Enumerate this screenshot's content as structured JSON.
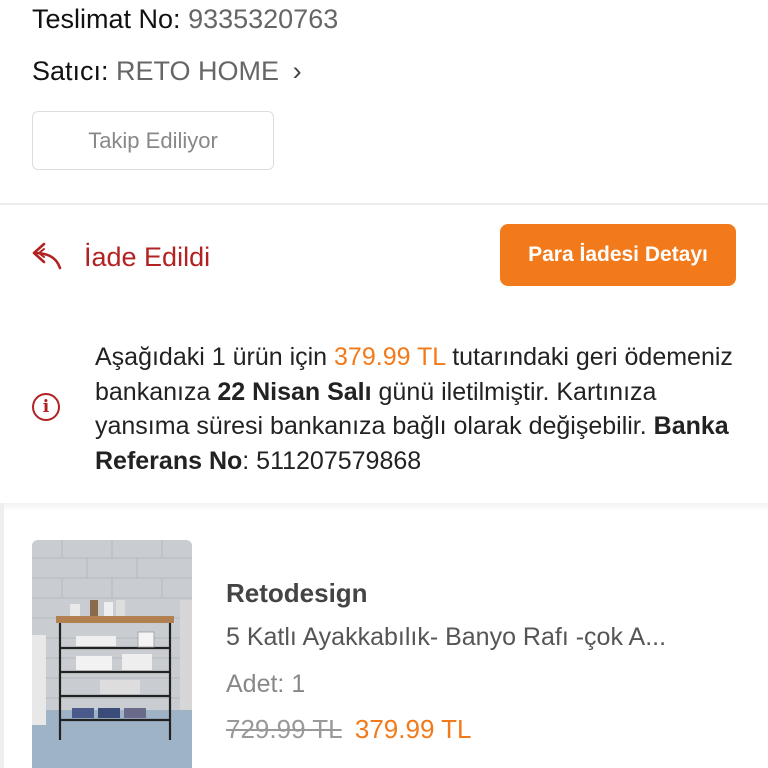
{
  "delivery": {
    "teslimat_label": "Teslimat No:",
    "teslimat_value": "9335320763",
    "satici_label": "Satıcı:",
    "satici_value": "RETO HOME",
    "chevron": "›",
    "follow_label": "Takip Ediliyor"
  },
  "status": {
    "icon": "return-arrow-icon",
    "label": "İade Edildi",
    "refund_button": "Para İadesi Detayı",
    "status_color": "#b22222",
    "accent_color": "#f27a1a"
  },
  "info": {
    "icon": "info-icon",
    "icon_glyph": "i",
    "t1": "Aşağıdaki 1 ürün için ",
    "amount": "379.99 TL",
    "t2": " tutarındaki geri ödemeniz bankanıza ",
    "date": "22 Nisan Salı",
    "t3": " günü iletilmiştir. Kartınıza yansıma süresi bankanıza bağlı olarak değişebilir. ",
    "ref_label": "Banka Referans No",
    "ref_sep": ": ",
    "ref_value": "511207579868"
  },
  "product": {
    "brand": "Retodesign",
    "name": "5 Katlı Ayakkabılık- Banyo Rafı -çok A...",
    "qty_label": "Adet:",
    "qty_value": "1",
    "old_price": "729.99 TL",
    "new_price": "379.99 TL"
  }
}
